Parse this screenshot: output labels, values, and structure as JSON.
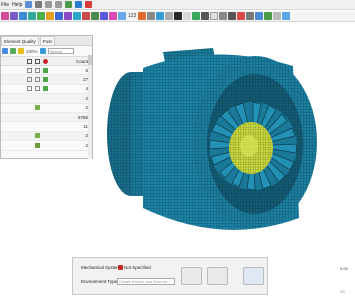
{
  "menu": {
    "items": [
      "File",
      "Help"
    ]
  },
  "toolbar": {
    "counter": "123"
  },
  "panel": {
    "tabs": [
      "Element Quality",
      "Post"
    ],
    "zoom": "100%",
    "search_placeholder": "Search",
    "count_header": "Count",
    "counts": [
      "6",
      "27",
      "4",
      "2",
      "2",
      "5756",
      "11",
      "2",
      "2"
    ]
  },
  "bottom": {
    "mech_label": "Mechanical System:",
    "mech_value": "Not Specified",
    "env_label": "Environment Type:",
    "env_placeholder": "Create Interior and Exterior..."
  },
  "viewport": {
    "scale_label": "0.00",
    "mesh_color": "#1a7898",
    "hub_color": "#c8d640"
  }
}
